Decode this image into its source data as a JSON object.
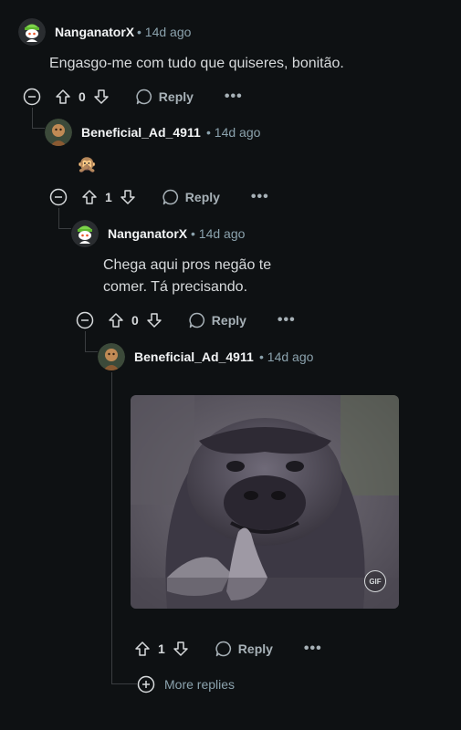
{
  "comments": [
    {
      "username": "NanganatorX",
      "time": "14d ago",
      "text": "Engasgo-me com tudo que quiseres, bonitão.",
      "votes": "0",
      "reply_label": "Reply",
      "more_label": "•••"
    },
    {
      "username": "Beneficial_Ad_4911",
      "time": "14d ago",
      "text": "🙊",
      "votes": "1",
      "reply_label": "Reply",
      "more_label": "•••"
    },
    {
      "username": "NanganatorX",
      "time": "14d ago",
      "text": "Chega aqui pros negão te comer. Tá precisando.",
      "votes": "0",
      "reply_label": "Reply",
      "more_label": "•••"
    },
    {
      "username": "Beneficial_Ad_4911",
      "time": "14d ago",
      "gif_badge": "GIF",
      "votes": "1",
      "reply_label": "Reply",
      "more_label": "•••"
    }
  ],
  "separator": "•",
  "more_replies_label": "More replies"
}
